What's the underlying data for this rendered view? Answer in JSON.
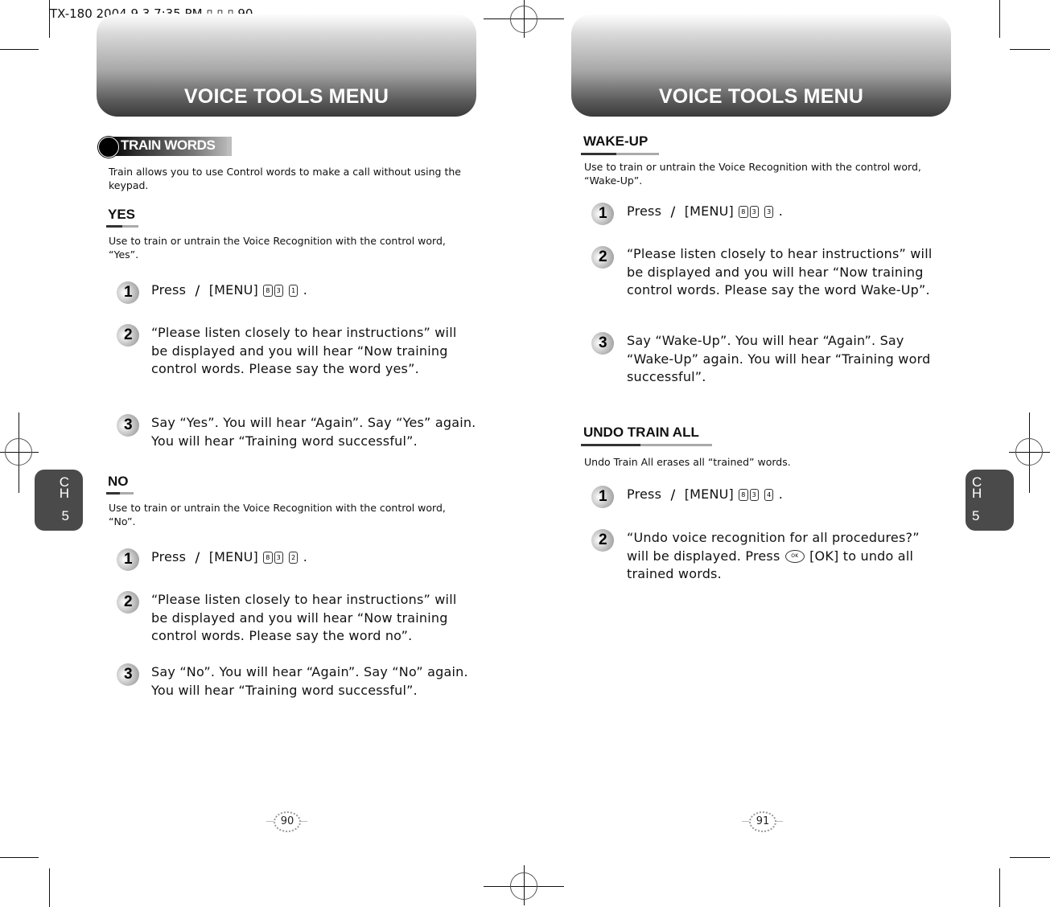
{
  "slug": "TX-180  2004.9.3 7:35 PM  ▯ ▯ ▯ 90",
  "left_page": {
    "banner_title": "VOICE TOOLS MENU",
    "section_pill": "TRAIN WORDS",
    "intro": "Train allows you to use Control words to make a call without using the keypad.",
    "chapter_tab": {
      "line1": "C",
      "line2": "H",
      "line3": "5"
    },
    "page_number": "90",
    "sections": [
      {
        "title": "YES",
        "description": "Use to train or untrain the Voice Recognition with the control word, “Yes”.",
        "steps": [
          {
            "num": "1",
            "pre": "Press",
            "menu": "[MENU]",
            "keys": [
              "8",
              "3",
              "1"
            ],
            "post": "."
          },
          {
            "num": "2",
            "text": "“Please listen closely to hear instructions” will be displayed and you will hear “Now training control words.  Please say the word yes”."
          },
          {
            "num": "3",
            "text": "Say “Yes”. You will hear “Again”. Say “Yes” again. You will hear “Training word successful”."
          }
        ]
      },
      {
        "title": "NO",
        "description": "Use to train or untrain the Voice Recognition with the control word, “No”.",
        "steps": [
          {
            "num": "1",
            "pre": "Press",
            "menu": "[MENU]",
            "keys": [
              "8",
              "3",
              "2"
            ],
            "post": "."
          },
          {
            "num": "2",
            "text": "“Please listen closely to hear instructions” will be displayed and you will hear “Now training control words.  Please say the word no”."
          },
          {
            "num": "3",
            "text": "Say “No”. You will hear “Again”. Say “No” again. You will hear “Training word successful”."
          }
        ]
      }
    ]
  },
  "right_page": {
    "banner_title": "VOICE TOOLS MENU",
    "chapter_tab": {
      "line1": "C",
      "line2": "H",
      "line3": "5"
    },
    "page_number": "91",
    "sections": [
      {
        "title": "WAKE-UP",
        "description": "Use to train or untrain the Voice Recognition with the control word, “Wake-Up”.",
        "steps": [
          {
            "num": "1",
            "pre": "Press",
            "menu": "[MENU]",
            "keys": [
              "8",
              "3",
              "3"
            ],
            "post": "."
          },
          {
            "num": "2",
            "text": "“Please listen closely to hear instructions” will be displayed and you will hear “Now training control words.  Please say the word Wake-Up”."
          },
          {
            "num": "3",
            "text": "Say “Wake-Up”. You will hear “Again”. Say “Wake-Up” again. You will hear “Training word successful”."
          }
        ]
      },
      {
        "title": "UNDO TRAIN ALL",
        "description": "Undo Train All erases all “trained” words.",
        "steps": [
          {
            "num": "1",
            "pre": "Press",
            "menu": "[MENU]",
            "keys": [
              "8",
              "3",
              "4"
            ],
            "post": "."
          },
          {
            "num": "2",
            "text_a": "“Undo voice recognition for all procedures?” will be displayed. Press",
            "ok_key": "OK",
            "text_b": "[OK] to undo all trained words."
          }
        ]
      }
    ]
  }
}
